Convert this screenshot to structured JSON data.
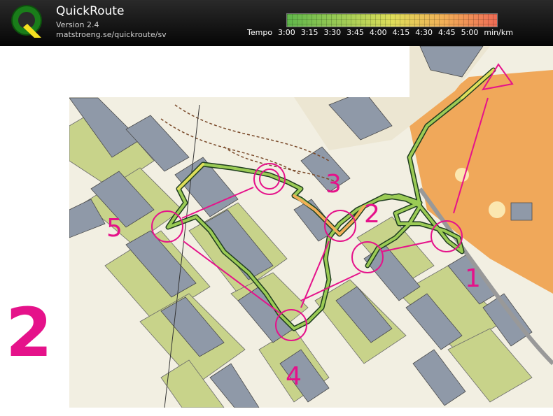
{
  "header": {
    "app_name": "QuickRoute",
    "version": "Version 2.4",
    "url": "matstroeng.se/quickroute/sv",
    "logo_letter": "Q"
  },
  "tempo_scale": {
    "label": "Tempo",
    "ticks": [
      "3:00",
      "3:15",
      "3:30",
      "3:45",
      "4:00",
      "4:15",
      "4:30",
      "4:45",
      "5:00"
    ],
    "unit": "min/km",
    "colors": [
      "#5fb64b",
      "#9bcb55",
      "#dede5a",
      "#f1ae57",
      "#ee6b55"
    ]
  },
  "map": {
    "lap_number": "2",
    "controls": [
      "1",
      "2",
      "3",
      "4",
      "5"
    ],
    "course_color": "#e5128a",
    "building_color": "#8f99a8",
    "open_land_color": "#f0a85a",
    "vegetation_color": "#c8d38a"
  }
}
